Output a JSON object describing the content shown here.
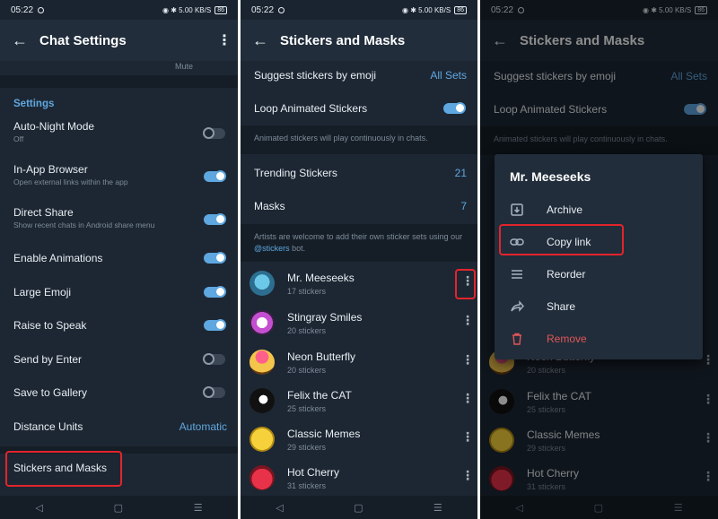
{
  "status_bar": {
    "time": "05:22",
    "indicators": "◉ ✱ 5.00 KB/S",
    "battery": "86"
  },
  "panel1": {
    "title": "Chat Settings",
    "top_label": "Mute",
    "section_title": "Settings",
    "rows": [
      {
        "label": "Auto-Night Mode",
        "sub": "Off",
        "toggle": "off"
      },
      {
        "label": "In-App Browser",
        "sub": "Open external links within the app",
        "toggle": "on"
      },
      {
        "label": "Direct Share",
        "sub": "Show recent chats in Android share menu",
        "toggle": "on"
      },
      {
        "label": "Enable Animations",
        "sub": "",
        "toggle": "on"
      },
      {
        "label": "Large Emoji",
        "sub": "",
        "toggle": "on"
      },
      {
        "label": "Raise to Speak",
        "sub": "",
        "toggle": "on"
      },
      {
        "label": "Send by Enter",
        "sub": "",
        "toggle": "off"
      },
      {
        "label": "Save to Gallery",
        "sub": "",
        "toggle": "off"
      }
    ],
    "distance_units": {
      "label": "Distance Units",
      "value": "Automatic"
    },
    "stickers_masks": "Stickers and Masks"
  },
  "panel2": {
    "title": "Stickers and Masks",
    "suggest": {
      "label": "Suggest stickers by emoji",
      "value": "All Sets"
    },
    "loop": {
      "label": "Loop Animated Stickers",
      "toggle": "on"
    },
    "loop_info": "Animated stickers will play continuously in chats.",
    "trending": {
      "label": "Trending Stickers",
      "value": "21"
    },
    "masks": {
      "label": "Masks",
      "value": "7"
    },
    "artists_info_prefix": "Artists are welcome to add their own sticker sets using our ",
    "artists_info_link": "@stickers",
    "artists_info_suffix": " bot.",
    "sticker_sets": [
      {
        "name": "Mr. Meeseeks",
        "count": "17 stickers"
      },
      {
        "name": "Stingray Smiles",
        "count": "20 stickers"
      },
      {
        "name": "Neon Butterfly",
        "count": "20 stickers"
      },
      {
        "name": "Felix the CAT",
        "count": "25 stickers"
      },
      {
        "name": "Classic Memes",
        "count": "29 stickers"
      },
      {
        "name": "Hot Cherry",
        "count": "31 stickers"
      }
    ]
  },
  "panel3": {
    "popup_title": "Mr. Meeseeks",
    "menu": [
      {
        "label": "Archive",
        "icon": "archive-icon"
      },
      {
        "label": "Copy link",
        "icon": "link-icon"
      },
      {
        "label": "Reorder",
        "icon": "reorder-icon"
      },
      {
        "label": "Share",
        "icon": "share-icon"
      },
      {
        "label": "Remove",
        "icon": "trash-icon"
      }
    ]
  },
  "nav": {
    "back": "◁",
    "home": "▢",
    "menu": "☰"
  },
  "colors": {
    "background": "#1d2733",
    "header": "#212d3b",
    "accent": "#5fa7e0",
    "highlight_box": "#e3242b",
    "danger": "#e05656"
  }
}
